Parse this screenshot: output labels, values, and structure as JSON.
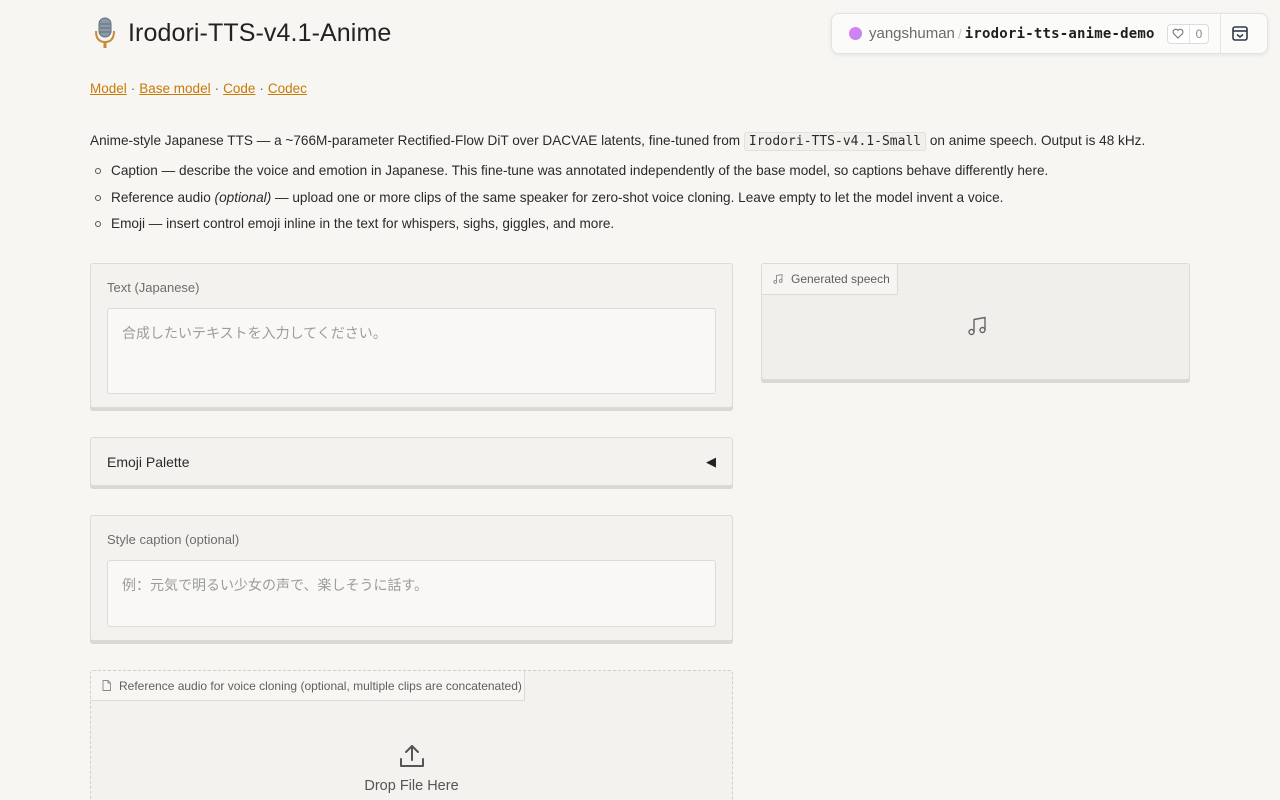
{
  "header": {
    "title": "Irodori-TTS-v4.1-Anime",
    "icon": "microphone-icon"
  },
  "hf_badge": {
    "user": "yangshuman",
    "repo": "irodori-tts-anime-demo",
    "likes": "0",
    "like_icon": "heart-icon",
    "embed_icon": "embed-icon"
  },
  "links": {
    "model": "Model",
    "base_model": "Base model",
    "code": "Code",
    "codec": "Codec",
    "separator": "·"
  },
  "description": {
    "intro_prefix": "Anime-style Japanese TTS — a ~766M-parameter Rectified-Flow DiT over DACVAE latents, fine-tuned from",
    "intro_code": "Irodori-TTS-v4.1-Small",
    "intro_suffix": "on anime speech. Output is 48 kHz.",
    "bullets": [
      {
        "lead": "Caption",
        "italic": "",
        "text": " — describe the voice and emotion in Japanese. This fine-tune was annotated independently of the base model, so captions behave differently here."
      },
      {
        "lead": "Reference audio ",
        "italic": "(optional)",
        "text": " — upload one or more clips of the same speaker for zero-shot voice cloning. Leave empty to let the model invent a voice."
      },
      {
        "lead": "Emoji",
        "italic": "",
        "text": " — insert control emoji inline in the text for whispers, sighs, giggles, and more."
      }
    ]
  },
  "text_input": {
    "label": "Text (Japanese)",
    "placeholder": "合成したいテキストを入力してください。",
    "value": ""
  },
  "emoji_palette": {
    "label": "Emoji Palette",
    "toggle": "◀"
  },
  "style_caption": {
    "label": "Style caption (optional)",
    "placeholder": "例：元気で明るい少女の声で、楽しそうに話す。",
    "value": ""
  },
  "reference_audio": {
    "label": "Reference audio for voice cloning (optional, multiple clips are concatenated)",
    "drop_text": "Drop File Here",
    "file_icon": "file-icon",
    "upload_icon": "upload-icon"
  },
  "output": {
    "label": "Generated speech",
    "icon": "music-note-icon"
  },
  "colors": {
    "link": "#c77a06",
    "background": "#f7f6f3",
    "panel": "#f3f2ef"
  }
}
